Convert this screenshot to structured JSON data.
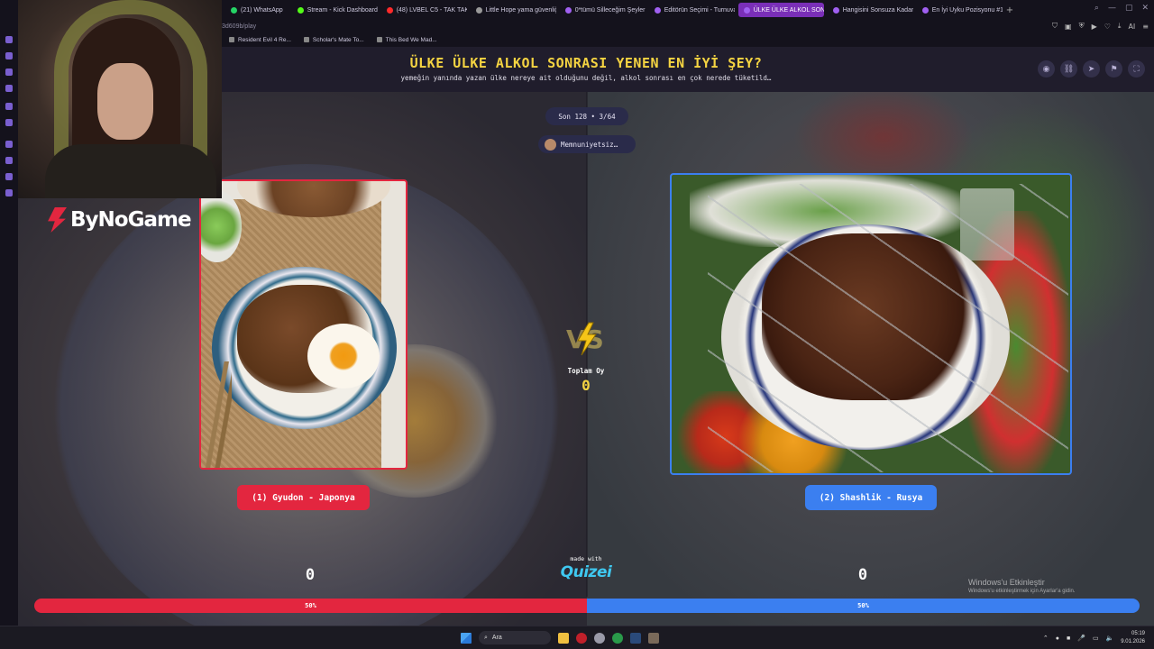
{
  "browser": {
    "tabs": [
      {
        "label": "(21) WhatsApp",
        "color": "#25d366",
        "active": false
      },
      {
        "label": "Stream - Kick Dashboard",
        "color": "#53fc18",
        "active": false
      },
      {
        "label": "(48) LVBEL C5 - TAK TAK",
        "color": "#ff2a2a",
        "active": false
      },
      {
        "label": "Little Hope yama güvenliği",
        "color": "#999999",
        "active": false
      },
      {
        "label": "0*tümü Silleceğim Şeyler",
        "color": "#a060f0",
        "active": false
      },
      {
        "label": "Editörün Seçimi - Turnuva",
        "color": "#a060f0",
        "active": false
      },
      {
        "label": "ÜLKE ÜLKE ALKOL SONRASI",
        "color": "#a060f0",
        "active": true
      },
      {
        "label": "Hangisini Sonsuza Kadar",
        "color": "#a060f0",
        "active": false
      },
      {
        "label": "En İyi Uyku Pozisyonu #1",
        "color": "#a060f0",
        "active": false
      }
    ],
    "new_tab": "+",
    "address": "3d609b/play",
    "bookmarks": [
      "Resident Evil 4 Re...",
      "Scholar's Mate To...",
      "This Bed We Mad..."
    ],
    "toolbar_ai": "AI"
  },
  "overlay": {
    "logo_text": "ByNoGame",
    "windows_activate_title": "Windows'u Etkinleştir",
    "windows_activate_sub": "Windows'u etkinleştirmek için Ayarlar'a gidin."
  },
  "game": {
    "title": "ÜLKE ÜLKE ALKOL SONRASI YENEN EN İYİ ŞEY?",
    "subtitle": "yemeğin yanında yazan ülke nereye ait olduğunu değil, alkol sonrası en çok nerede tüketild…",
    "round": "Son 128 • 3/64",
    "user": "Memnuniyetsiz…",
    "left_name": "(1) Gyudon - Japonya",
    "right_name": "(2) Shashlik - Rusya",
    "total_votes_label": "Toplam Oy",
    "total_votes": "0",
    "made_with": "made with",
    "brand": "Quizei",
    "left_score": "0",
    "right_score": "0",
    "left_percent_label": "50%",
    "right_percent_label": "50%",
    "left_share": 0.5
  },
  "colors": {
    "accent_yellow": "#f5d442",
    "left_red": "#e3263f",
    "right_blue": "#3b7ff0",
    "brand_cyan": "#3fc8f0"
  },
  "taskbar": {
    "search_placeholder": "Ara",
    "time": "05:19",
    "date": "9.01.2026"
  }
}
